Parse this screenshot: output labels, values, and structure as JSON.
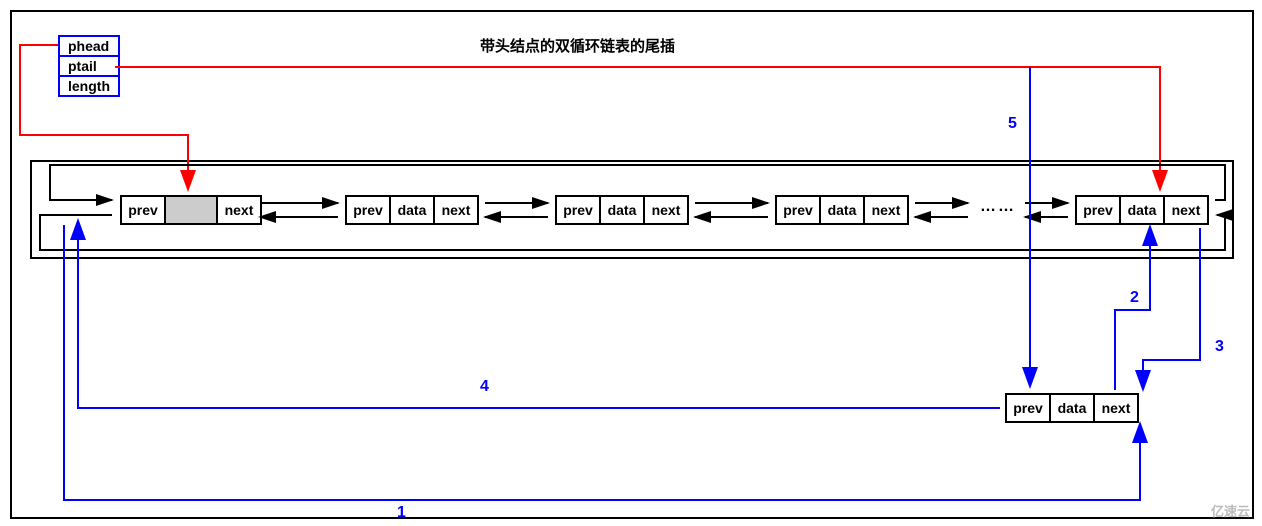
{
  "title": "带头结点的双循环链表的尾插",
  "list_fields": {
    "f1": "phead",
    "f2": "ptail",
    "f3": "length"
  },
  "node_parts": {
    "prev": "prev",
    "data": "data",
    "next": "next"
  },
  "ellipsis": "……",
  "steps": {
    "s1": "1",
    "s2": "2",
    "s3": "3",
    "s4": "4",
    "s5": "5"
  },
  "watermark": "亿速云"
}
